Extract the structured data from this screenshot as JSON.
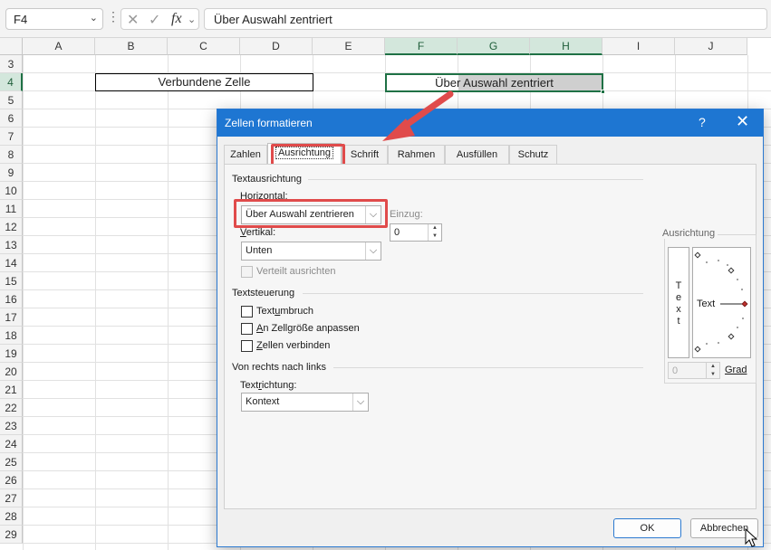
{
  "formula_bar": {
    "name_box": "F4",
    "name_box_chevron": "⌄",
    "more_icon": "⋮",
    "cancel_icon": "✕",
    "enter_icon": "✓",
    "fx_label": "fx",
    "fx_chevron": "⌄",
    "formula": "Über Auswahl zentriert"
  },
  "sheet": {
    "columns": [
      "A",
      "B",
      "C",
      "D",
      "E",
      "F",
      "G",
      "H",
      "I",
      "J"
    ],
    "selected_columns": [
      "F",
      "G",
      "H"
    ],
    "rows": [
      "3",
      "4",
      "5",
      "6",
      "7",
      "8",
      "9",
      "10",
      "11",
      "12",
      "13",
      "14",
      "15",
      "16",
      "17",
      "18",
      "19",
      "20",
      "21",
      "22",
      "23",
      "24",
      "25",
      "26",
      "27",
      "28",
      "29"
    ],
    "selected_row": "4",
    "merged_cell_text": "Verbundene Zelle",
    "center_across_text": "Über Auswahl zentriert"
  },
  "dialog": {
    "title": "Zellen formatieren",
    "help_label": "?",
    "close_label": "✕",
    "tabs": [
      "Zahlen",
      "Ausrichtung",
      "Schrift",
      "Rahmen",
      "Ausfüllen",
      "Schutz"
    ],
    "active_tab": "Ausrichtung",
    "text_alignment": {
      "section_label": "Textausrichtung",
      "horizontal_label_underlined": "H",
      "horizontal_label_rest": "orizontal:",
      "horizontal_value": "Über Auswahl zentrieren",
      "indent_label": "Einzug:",
      "indent_value": "0",
      "vertical_label_underlined": "V",
      "vertical_label_rest": "ertikal:",
      "vertical_value": "Unten",
      "distributed_label": "Verteilt ausrichten",
      "distributed_checked": false
    },
    "text_control": {
      "section_label": "Textsteuerung",
      "wrap_pre": "Text",
      "wrap_u": "u",
      "wrap_post": "mbruch",
      "shrink_u": "A",
      "shrink_post": "n Zellgröße anpassen",
      "merge_u": "Z",
      "merge_post": "ellen verbinden"
    },
    "rtl": {
      "section_label": "Von rechts nach links",
      "direction_pre": "Text",
      "direction_u": "r",
      "direction_post": "ichtung:",
      "direction_value": "Kontext"
    },
    "orientation": {
      "section_label": "Ausrichtung",
      "vertical_text": [
        "T",
        "e",
        "x",
        "t"
      ],
      "horizontal_text": "Text",
      "degrees_value": "0",
      "degrees_label": "Grad"
    },
    "ok_label": "OK",
    "cancel_label": "Abbrechen"
  },
  "annotation": {
    "arrow_color": "#e04b4b",
    "highlight_color": "#e04b4b"
  }
}
